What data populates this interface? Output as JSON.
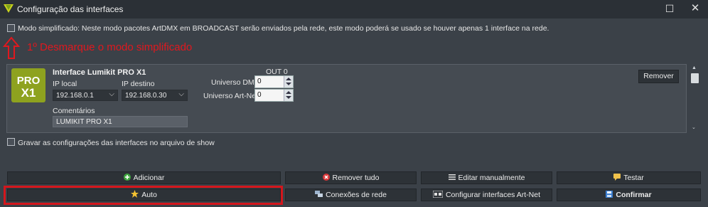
{
  "window": {
    "title": "Configuração das interfaces",
    "maximize_glyph": "☐",
    "close_glyph": "✕"
  },
  "simplified_mode": {
    "checked": false,
    "label": "Modo simplificado: Neste modo pacotes ArtDMX em BROADCAST serão enviados pela rede, este modo poderá se usado se houver apenas 1 interface na rede."
  },
  "annotation": {
    "text": "1º Desmarque o modo simplificado",
    "color": "#e0181e"
  },
  "interface": {
    "logo_text_top": "PRO",
    "logo_text_bottom": "X1",
    "name": "Interface Lumikit PRO X1",
    "ip_local_label": "IP local",
    "ip_local_value": "192.168.0.1",
    "ip_dest_label": "IP destino",
    "ip_dest_value": "192.168.0.30",
    "out_label": "OUT 0",
    "dmx_universe_label": "Universo DMX",
    "dmx_universe_value": "0",
    "artnet_universe_label": "Universo Art-Net",
    "artnet_universe_value": "0",
    "comments_label": "Comentários",
    "comments_value": "LUMIKIT PRO X1",
    "remove_button": "Remover"
  },
  "save_config": {
    "checked": false,
    "label": "Gravar as configurações das interfaces no arquivo de show"
  },
  "actions": {
    "add": "Adicionar",
    "remove_all": "Remover tudo",
    "edit_manual": "Editar manualmente",
    "test": "Testar",
    "auto": "Auto",
    "network_connections": "Conexões de rede",
    "configure_artnet": "Configurar interfaces Art-Net",
    "confirm": "Confirmar"
  },
  "colors": {
    "background": "#3b4148",
    "titlebar": "#2b3036",
    "button": "#2d3237",
    "highlight": "#d4161c",
    "logo_green": "#8ea21f"
  }
}
